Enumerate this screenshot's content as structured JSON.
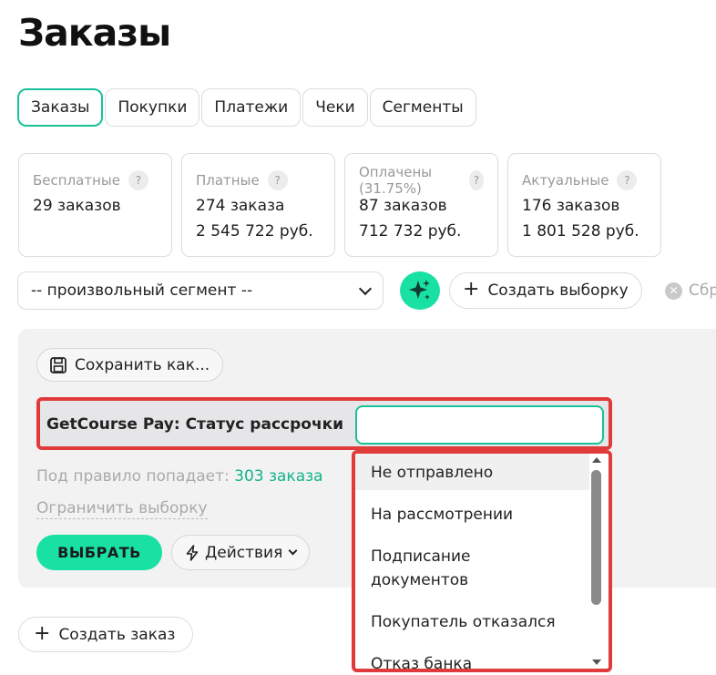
{
  "page": {
    "title": "Заказы"
  },
  "tabs": [
    {
      "label": "Заказы",
      "active": true
    },
    {
      "label": "Покупки"
    },
    {
      "label": "Платежи"
    },
    {
      "label": "Чеки"
    },
    {
      "label": "Сегменты"
    }
  ],
  "stats": [
    {
      "title": "Бесплатные",
      "line1": "29 заказов",
      "line2": ""
    },
    {
      "title": "Платные",
      "line1": "274 заказа",
      "line2": "2 545 722 руб."
    },
    {
      "title": "Оплачены (31.75%)",
      "line1": "87 заказов",
      "line2": "712 732 руб."
    },
    {
      "title": "Актуальные",
      "line1": "176 заказов",
      "line2": "1 801 528 руб."
    }
  ],
  "help_glyph": "?",
  "segment": {
    "value": "-- произвольный сегмент --"
  },
  "toolbar": {
    "create_selection": "Создать выборку",
    "reset": "Сбр",
    "plus": "+",
    "reset_x": "✕"
  },
  "filter": {
    "save_as": "Сохранить как...",
    "rule_label": "GetCourse Pay: Статус рассрочки",
    "rule_value": "",
    "count_prefix": "Под правило попадает:",
    "count_link": "303 заказа",
    "limit": "Ограничить выборку",
    "select_button": "ВЫБРАТЬ",
    "actions_button": "Действия"
  },
  "dropdown": {
    "options": [
      "Не отправлено",
      "На рассмотрении",
      "Подписание документов",
      "Покупатель отказался",
      "Отказ банка"
    ],
    "highlighted_index": 0
  },
  "footer": {
    "create_order": "Создать заказ"
  },
  "colors": {
    "accent": "#19e0a3",
    "accent_border": "#18c29a",
    "highlight_red": "#e03a3a",
    "link": "#12b48a"
  }
}
